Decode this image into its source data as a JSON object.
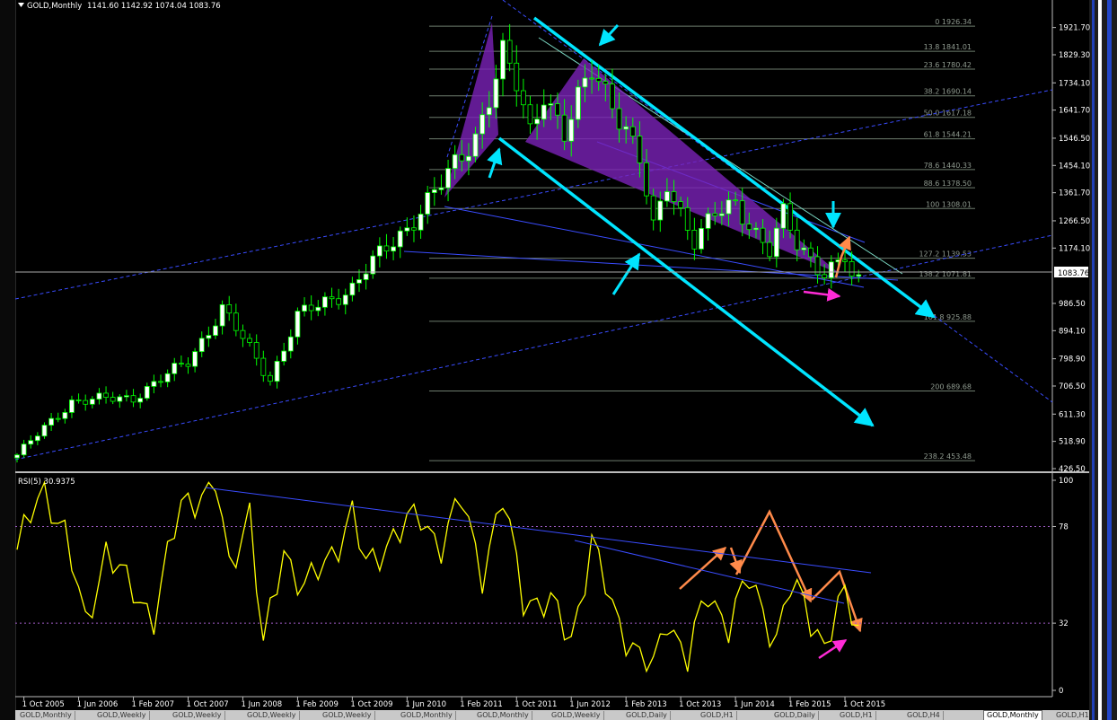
{
  "window": {
    "symbol_caption": "GOLD,Monthly",
    "ohlc_caption": "1141.60 1142.92 1074.04 1083.76",
    "dropdown_icon": "triangle-down-icon"
  },
  "current_price": "1083.76",
  "price_axis_labels": [
    "1921.70",
    "1829.30",
    "1734.10",
    "1641.70",
    "1546.50",
    "1454.10",
    "1361.70",
    "1266.50",
    "1174.10",
    "986.50",
    "894.10",
    "798.90",
    "706.50",
    "611.30",
    "518.90",
    "426.50"
  ],
  "time_axis_labels": [
    "1 Oct 2005",
    "1 Jun 2006",
    "1 Feb 2007",
    "1 Oct 2007",
    "1 Jun 2008",
    "1 Feb 2009",
    "1 Oct 2009",
    "1 Jun 2010",
    "1 Feb 2011",
    "1 Oct 2011",
    "1 Jun 2012",
    "1 Feb 2013",
    "1 Oct 2013",
    "1 Jun 2014",
    "1 Feb 2015",
    "1 Oct 2015"
  ],
  "fibonacci_labels": [
    "0 1926.34",
    "13.8 1841.01",
    "23.6 1780.42",
    "38.2 1690.14",
    "50.0 1617.18",
    "61.8 1544.21",
    "78.6 1440.33",
    "88.6 1378.50",
    "100 1308.01",
    "127.2 1139.53",
    "138.2 1071.81",
    "161.8 925.88",
    "200 689.68",
    "238.2 453.48"
  ],
  "rsi": {
    "caption": "RSI(5) 30.9375",
    "axis_labels": [
      "100",
      "78",
      "32",
      "0"
    ],
    "levels": [
      78,
      32
    ]
  },
  "tabs": [
    "GOLD,Monthly",
    "GOLD,Weekly",
    "GOLD,Weekly",
    "GOLD,Weekly",
    "GOLD,Weekly",
    "GOLD,Monthly",
    "GOLD,Monthly",
    "GOLD,Weekly",
    "GOLD,Daily",
    "GOLD,H1",
    "GOLD,Daily",
    "GOLD,H1",
    "GOLD,H4",
    "GOLD,Weekly",
    "GOLD,H1",
    "GOLD,Monthly"
  ],
  "active_tab_index": 15,
  "colors": {
    "background": "#000000",
    "bull_candle": "#ffffff",
    "bear_candle": "#000000",
    "wick": "#00ff00",
    "rsi_line": "#ffff00",
    "trendline": "#3a4cff",
    "channel": "#00e5ff",
    "fib": "#6e7c6e",
    "harmonic_fill": "#7a22b8",
    "arrow_orange": "#ff8a4a",
    "arrow_magenta": "#ff2bd6"
  },
  "chart_data": [
    {
      "type": "candlestick",
      "title": "GOLD,Monthly",
      "x_range": [
        "2005-09",
        "2017-05"
      ],
      "ylim": [
        426.5,
        1926.34
      ],
      "price_axis_ticks": [
        1921.7,
        1829.3,
        1734.1,
        1641.7,
        1546.5,
        1454.1,
        1361.7,
        1266.5,
        1174.1,
        986.5,
        894.1,
        798.9,
        706.5,
        611.3,
        518.9,
        426.5
      ],
      "last_close": 1083.76,
      "approx_close_path": [
        [
          "2005-09",
          473
        ],
        [
          "2006-05",
          655
        ],
        [
          "2007-02",
          668
        ],
        [
          "2007-10",
          790
        ],
        [
          "2008-03",
          968
        ],
        [
          "2008-10",
          730
        ],
        [
          "2009-02",
          942
        ],
        [
          "2009-10",
          1040
        ],
        [
          "2009-12",
          1100
        ],
        [
          "2010-06",
          1245
        ],
        [
          "2010-12",
          1420
        ],
        [
          "2011-04",
          1556
        ],
        [
          "2011-08",
          1826
        ],
        [
          "2011-10",
          1725
        ],
        [
          "2011-12",
          1566
        ],
        [
          "2012-02",
          1710
        ],
        [
          "2012-05",
          1560
        ],
        [
          "2012-09",
          1776
        ],
        [
          "2012-12",
          1675
        ],
        [
          "2013-02",
          1578
        ],
        [
          "2013-04",
          1472
        ],
        [
          "2013-06",
          1234
        ],
        [
          "2013-08",
          1396
        ],
        [
          "2013-12",
          1202
        ],
        [
          "2014-03",
          1284
        ],
        [
          "2014-06",
          1322
        ],
        [
          "2014-11",
          1167
        ],
        [
          "2015-01",
          1284
        ],
        [
          "2015-03",
          1183
        ],
        [
          "2015-07",
          1095
        ],
        [
          "2015-10",
          1142
        ],
        [
          "2015-11",
          1065
        ],
        [
          "2015-12",
          1083.76
        ]
      ],
      "fibonacci": [
        [
          0,
          1926.34
        ],
        [
          13.8,
          1841.01
        ],
        [
          23.6,
          1780.42
        ],
        [
          38.2,
          1690.14
        ],
        [
          50.0,
          1617.18
        ],
        [
          61.8,
          1544.21
        ],
        [
          78.6,
          1440.33
        ],
        [
          88.6,
          1378.5
        ],
        [
          100,
          1308.01
        ],
        [
          127.2,
          1139.53
        ],
        [
          138.2,
          1071.81
        ],
        [
          161.8,
          925.88
        ],
        [
          200,
          689.68
        ],
        [
          238.2,
          453.48
        ]
      ]
    },
    {
      "type": "line",
      "title": "RSI(5) 30.9375",
      "ylim": [
        0,
        100
      ],
      "levels": [
        78,
        32
      ],
      "last_value": 30.9375,
      "approx_series": [
        [
          "2005-09",
          67
        ],
        [
          "2006-01",
          97
        ],
        [
          "2006-04",
          75
        ],
        [
          "2006-07",
          30
        ],
        [
          "2006-10",
          68
        ],
        [
          "2007-01",
          50
        ],
        [
          "2007-05",
          36
        ],
        [
          "2007-09",
          88
        ],
        [
          "2007-12",
          95
        ],
        [
          "2008-02",
          98
        ],
        [
          "2008-04",
          57
        ],
        [
          "2008-07",
          87
        ],
        [
          "2008-09",
          19
        ],
        [
          "2008-12",
          67
        ],
        [
          "2009-03",
          49
        ],
        [
          "2009-06",
          59
        ],
        [
          "2009-10",
          85
        ],
        [
          "2009-12",
          57
        ],
        [
          "2010-04",
          75
        ],
        [
          "2010-08",
          82
        ],
        [
          "2010-11",
          70
        ],
        [
          "2011-02",
          90
        ],
        [
          "2011-05",
          57
        ],
        [
          "2011-08",
          90
        ],
        [
          "2011-11",
          45
        ],
        [
          "2012-03",
          40
        ],
        [
          "2012-06",
          25
        ],
        [
          "2012-09",
          70
        ],
        [
          "2012-12",
          39
        ],
        [
          "2013-04",
          16
        ],
        [
          "2013-06",
          9
        ],
        [
          "2013-08",
          36
        ],
        [
          "2013-11",
          15
        ],
        [
          "2014-02",
          46
        ],
        [
          "2014-05",
          32
        ],
        [
          "2014-08",
          52
        ],
        [
          "2014-12",
          25
        ],
        [
          "2015-02",
          48
        ],
        [
          "2015-04",
          42
        ],
        [
          "2015-07",
          22
        ],
        [
          "2015-10",
          44
        ],
        [
          "2015-12",
          30.9375
        ]
      ]
    }
  ]
}
